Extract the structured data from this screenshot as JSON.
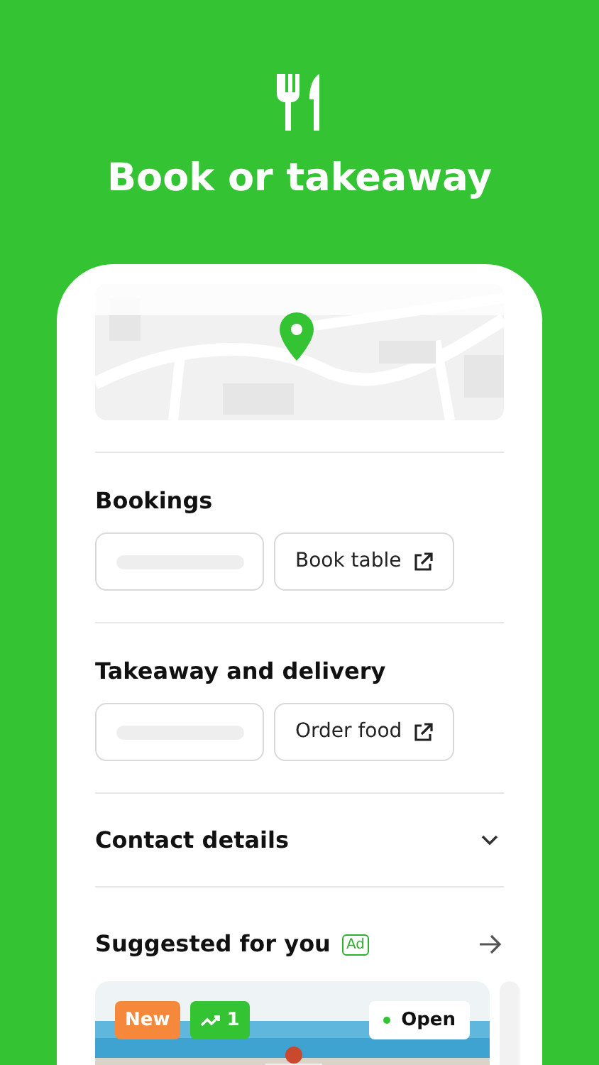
{
  "headline": "Book or takeaway",
  "sections": [
    {
      "kind": "actions",
      "title": "Bookings",
      "buttons": [
        {
          "kind": "skeleton"
        },
        {
          "kind": "link",
          "label": "Book table"
        }
      ]
    },
    {
      "kind": "actions",
      "title": "Takeaway and delivery",
      "buttons": [
        {
          "kind": "skeleton"
        },
        {
          "kind": "link",
          "label": "Order food"
        }
      ]
    },
    {
      "kind": "collapsible",
      "title": "Contact details",
      "expanded": false
    },
    {
      "kind": "carousel",
      "title": "Suggested for you",
      "badge": "Ad",
      "cards": [
        {
          "kind": "full",
          "badges": [
            {
              "kind": "new",
              "label": "New"
            },
            {
              "kind": "trending",
              "label": "1"
            }
          ],
          "status": {
            "label": "Open",
            "open": true
          }
        },
        {
          "kind": "peek"
        }
      ]
    }
  ]
}
